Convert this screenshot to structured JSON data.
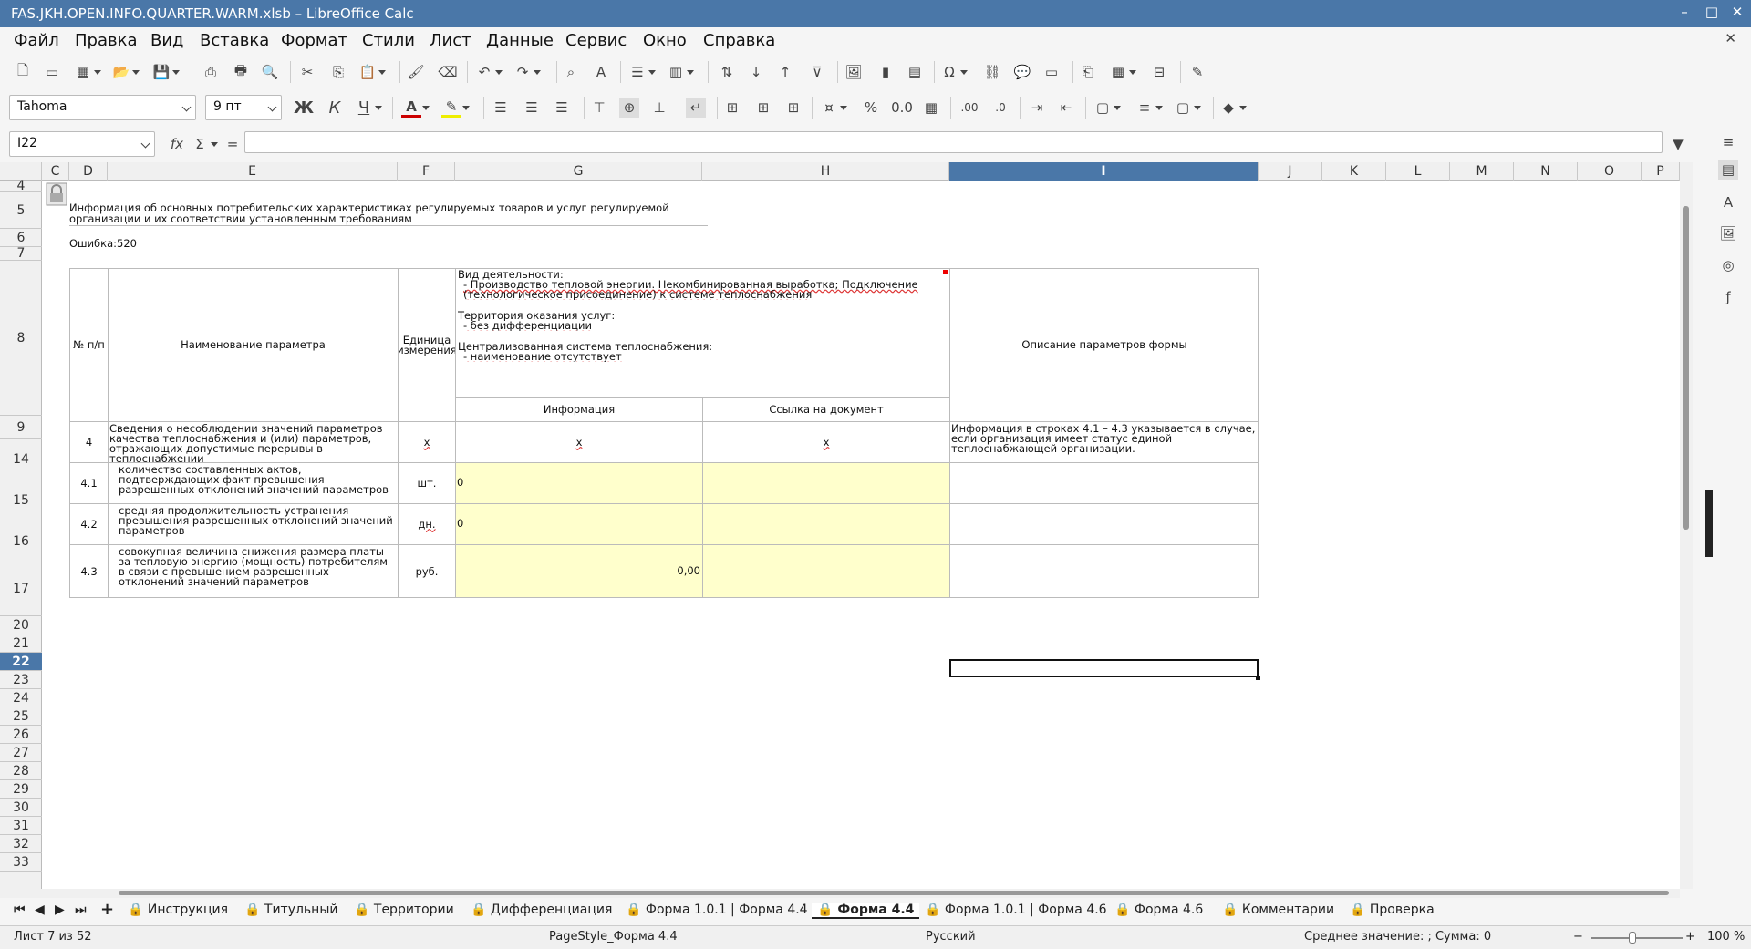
{
  "window": {
    "title": "FAS.JKH.OPEN.INFO.QUARTER.WARM.xlsb – LibreOffice Calc"
  },
  "menu": [
    "Файл",
    "Правка",
    "Вид",
    "Вставка",
    "Формат",
    "Стили",
    "Лист",
    "Данные",
    "Сервис",
    "Окно",
    "Справка"
  ],
  "format_bar": {
    "font_name": "Tahoma",
    "font_size": "9 пт"
  },
  "formula_bar": {
    "cell_ref": "I22",
    "formula": ""
  },
  "columns": [
    "C",
    "D",
    "E",
    "F",
    "G",
    "H",
    "I",
    "J",
    "K",
    "L",
    "M",
    "N",
    "O",
    "P"
  ],
  "rows": [
    "4",
    "5",
    "6",
    "7",
    "8",
    "9",
    "14",
    "15",
    "16",
    "17",
    "20",
    "21",
    "22",
    "23",
    "24",
    "25",
    "26",
    "27",
    "28",
    "29",
    "30",
    "31",
    "32",
    "33"
  ],
  "sheet": {
    "title": "Информация об основных потребительских характеристиках регулируемых товаров и услуг регулируемой организации и их соответствии установленным требованиям",
    "error": "Ошибка:520",
    "hdr_num": "№ п/п",
    "hdr_name": "Наименование параметра",
    "hdr_unit": "Единица измерения",
    "activity_l1": "Вид деятельности:",
    "activity_l2": "- Производство тепловой энергии. Некомбинированная выработка; Подключение (технологическое присоединение) к системе теплоснабжения",
    "territory_l1": "Территория оказания услуг:",
    "territory_l2": "- без дифференциации",
    "system_l1": "Централизованная система теплоснабжения:",
    "system_l2": "- наименование отсутствует",
    "hdr_desc": "Описание параметров формы",
    "hdr_info": "Информация",
    "hdr_doc": "Ссылка на документ",
    "rows": [
      {
        "num": "4",
        "name": "Сведения о несоблюдении значений параметров качества теплоснабжения и (или) параметров, отражающих допустимые перерывы в теплоснабжении",
        "unit": "x",
        "info": "x",
        "doc": "x",
        "desc": "Информация в строках 4.1 – 4.3 указывается в случае, если организация имеет статус единой теплоснабжающей организации."
      },
      {
        "num": "4.1",
        "name": "количество составленных актов, подтверждающих факт превышения разрешенных отклонений значений параметров",
        "unit": "шт.",
        "info": "0",
        "doc": "",
        "desc": ""
      },
      {
        "num": "4.2",
        "name": "средняя продолжительность устранения превышения разрешенных отклонений значений параметров",
        "unit": "дн.",
        "info": "0",
        "doc": "",
        "desc": ""
      },
      {
        "num": "4.3",
        "name": "совокупная величина снижения размера платы за тепловую энергию (мощность) потребителям в связи с превышением разрешенных отклонений значений параметров",
        "unit": "руб.",
        "info": "0,00",
        "doc": "",
        "desc": ""
      }
    ]
  },
  "tabs": [
    "Инструкция",
    "Титульный",
    "Территории",
    "Дифференциация",
    "Форма 1.0.1 | Форма 4.4",
    "Форма 4.4",
    "Форма 1.0.1 | Форма 4.6",
    "Форма 4.6",
    "Комментарии",
    "Проверка"
  ],
  "status": {
    "sheet": "Лист 7 из 52",
    "style": "PageStyle_Форма 4.4",
    "lang": "Русский",
    "sum": "Среднее значение: ; Сумма: 0",
    "zoom": "100 %"
  }
}
